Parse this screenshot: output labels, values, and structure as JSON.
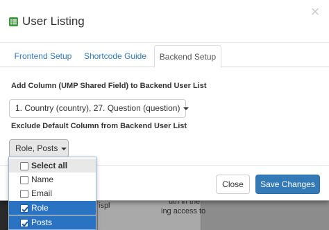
{
  "modal": {
    "title": "User Listing",
    "close_symbol": "×"
  },
  "tabs": [
    {
      "label": "Frontend Setup",
      "active": false
    },
    {
      "label": "Shortcode Guide",
      "active": false
    },
    {
      "label": "Backend Setup",
      "active": true
    }
  ],
  "add_column": {
    "label": "Add Column (UMP Shared Field) to Backend User List",
    "selected_value": "1. Country (country), 27. Question (question)"
  },
  "exclude_column": {
    "label": "Exclude Default Column from Backend User List",
    "selected_value": "Role, Posts",
    "options": [
      {
        "label": "Select all",
        "checked": false
      },
      {
        "label": "Name",
        "checked": false
      },
      {
        "label": "Email",
        "checked": false
      },
      {
        "label": "Role",
        "checked": true
      },
      {
        "label": "Posts",
        "checked": true
      }
    ]
  },
  "footer": {
    "close_label": "Close",
    "save_label": "Save Changes"
  },
  "background_text": {
    "line1": "ispl",
    "line1b": "uth in the",
    "line2": "ing access to"
  },
  "colors": {
    "primary": "#337ab7",
    "link": "#337ab7",
    "selected_row": "#2a73c2",
    "title_icon": "#3a9a3a"
  },
  "icons": {
    "title_icon": "list-icon",
    "close": "close-icon",
    "check": "check-icon"
  }
}
